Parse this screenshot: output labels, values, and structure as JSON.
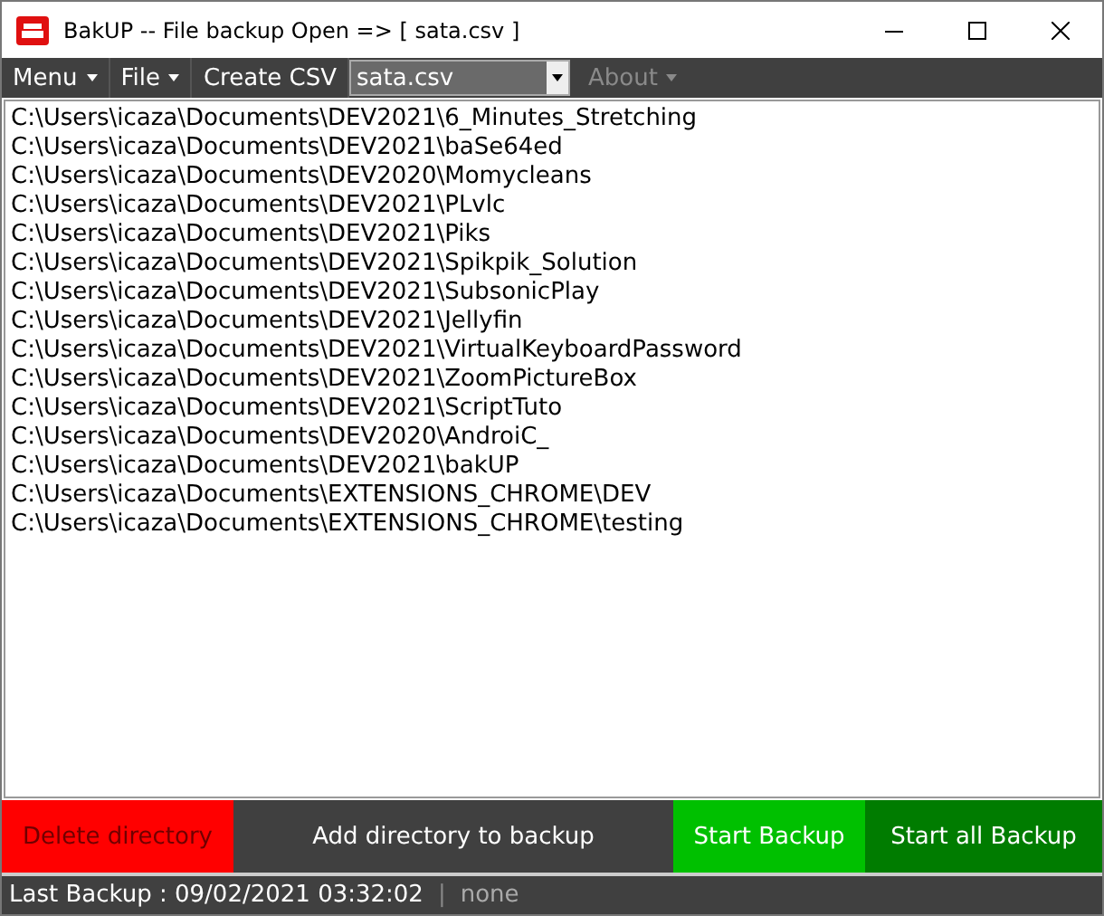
{
  "window": {
    "title": "BakUP -- File backup Open => [ sata.csv ]"
  },
  "menu": [
    {
      "kind": "menu",
      "label": "Menu",
      "disabled": false
    },
    {
      "kind": "menu",
      "label": "File",
      "disabled": false
    },
    {
      "kind": "item",
      "label": "Create CSV",
      "disabled": false
    },
    {
      "kind": "combo",
      "value": "sata.csv",
      "disabled": false
    },
    {
      "kind": "menu",
      "label": "About",
      "disabled": true
    }
  ],
  "directories": [
    "C:\\Users\\icaza\\Documents\\DEV2021\\6_Minutes_Stretching",
    "C:\\Users\\icaza\\Documents\\DEV2021\\baSe64ed",
    "C:\\Users\\icaza\\Documents\\DEV2020\\Momycleans",
    "C:\\Users\\icaza\\Documents\\DEV2021\\PLvlc",
    "C:\\Users\\icaza\\Documents\\DEV2021\\Piks",
    "C:\\Users\\icaza\\Documents\\DEV2021\\Spikpik_Solution",
    "C:\\Users\\icaza\\Documents\\DEV2021\\SubsonicPlay",
    "C:\\Users\\icaza\\Documents\\DEV2021\\Jellyfin",
    "C:\\Users\\icaza\\Documents\\DEV2021\\VirtualKeyboardPassword",
    "C:\\Users\\icaza\\Documents\\DEV2021\\ZoomPictureBox",
    "C:\\Users\\icaza\\Documents\\DEV2021\\ScriptTuto",
    "C:\\Users\\icaza\\Documents\\DEV2020\\AndroiC_",
    "C:\\Users\\icaza\\Documents\\DEV2021\\bakUP",
    "C:\\Users\\icaza\\Documents\\EXTENSIONS_CHROME\\DEV",
    "C:\\Users\\icaza\\Documents\\EXTENSIONS_CHROME\\testing"
  ],
  "buttons": [
    {
      "label": "Delete directory",
      "color": "#ff0000"
    },
    {
      "label": "Add directory to backup",
      "color": "#404040"
    },
    {
      "label": "Start Backup",
      "color": "#00c000"
    },
    {
      "label": "Start all Backup",
      "color": "#007c00"
    }
  ],
  "status_bar": {
    "last_backup": "Last Backup : 09/02/2021 03:32:02",
    "separator": "|",
    "current": "none"
  }
}
